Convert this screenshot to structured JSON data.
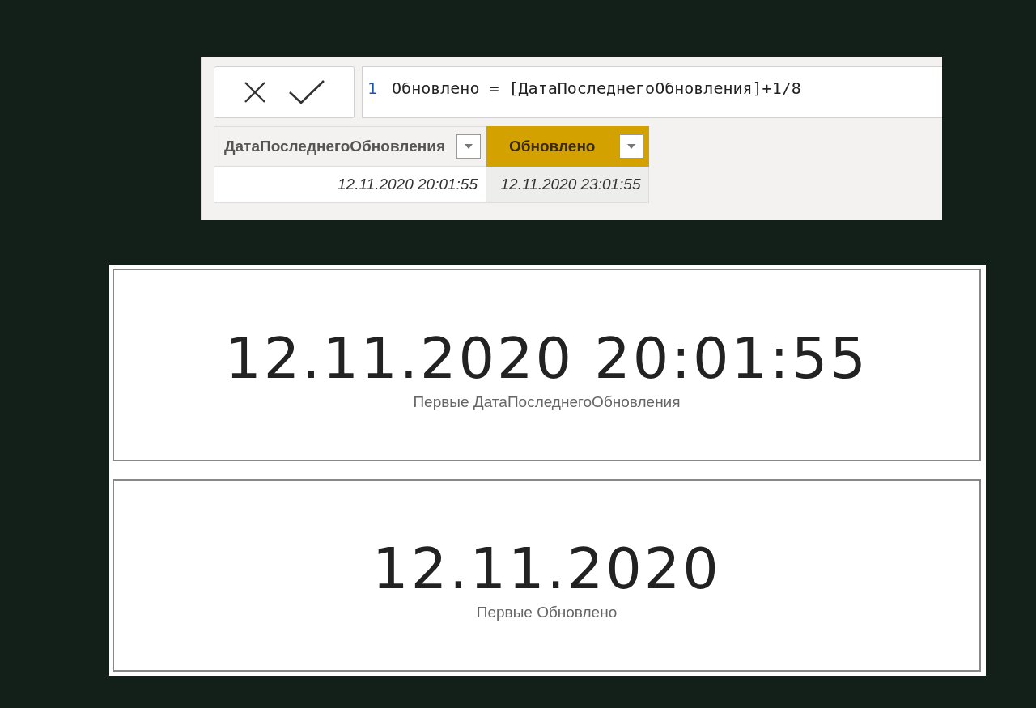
{
  "formula_bar": {
    "line_number": "1",
    "formula": "Обновлено = [ДатаПоследнегоОбновления]+1/8"
  },
  "table": {
    "columns": [
      {
        "label": "ДатаПоследнегоОбновления",
        "selected": false
      },
      {
        "label": "Обновлено",
        "selected": true
      }
    ],
    "rows": [
      [
        "12.11.2020 20:01:55",
        "12.11.2020 23:01:55"
      ]
    ]
  },
  "cards": [
    {
      "value": "12.11.2020 20:01:55",
      "label": "Первые ДатаПоследнегоОбновления"
    },
    {
      "value": "12.11.2020",
      "label": "Первые Обновлено"
    }
  ]
}
